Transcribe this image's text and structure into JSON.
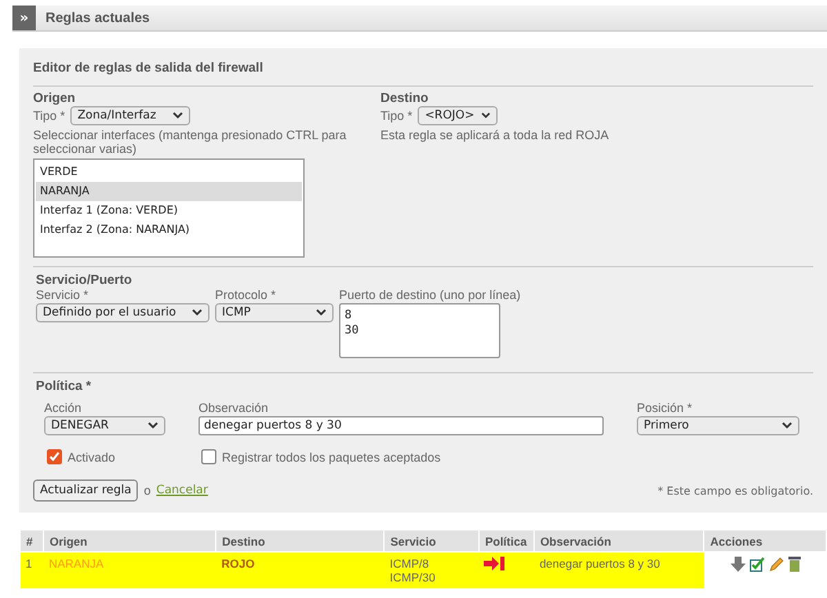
{
  "header": {
    "toggle": "»",
    "title": "Reglas actuales"
  },
  "editor": {
    "title": "Editor de reglas de salida del firewall",
    "origin": {
      "heading": "Origen",
      "type_label": "Tipo *",
      "type_value": "Zona/Interfaz",
      "hint": "Seleccionar interfaces (mantenga presionado CTRL para seleccionar varias)",
      "interfaces": [
        {
          "label": "VERDE",
          "selected": false
        },
        {
          "label": "NARANJA",
          "selected": true
        },
        {
          "label": "Interfaz 1 (Zona: VERDE)",
          "selected": false
        },
        {
          "label": "Interfaz 2 (Zona: NARANJA)",
          "selected": false
        }
      ]
    },
    "destination": {
      "heading": "Destino",
      "type_label": "Tipo *",
      "type_value": "<ROJO>",
      "note": "Esta regla se aplicará a toda la red ROJA"
    },
    "service": {
      "heading": "Servicio/Puerto",
      "service_label": "Servicio *",
      "service_value": "Definido por el usuario",
      "protocol_label": "Protocolo *",
      "protocol_value": "ICMP",
      "ports_label": "Puerto de destino (uno por línea)",
      "ports_value": "8\n30"
    },
    "policy": {
      "heading": "Política *",
      "action_label": "Acción",
      "action_value": "DENEGAR",
      "remark_label": "Observación",
      "remark_value": "denegar puertos 8 y 30",
      "position_label": "Posición *",
      "position_value": "Primero",
      "enabled": {
        "label": "Activado",
        "checked": true
      },
      "log": {
        "label": "Registrar todos los paquetes aceptados",
        "checked": false
      }
    },
    "update_button": "Actualizar regla",
    "or": "o",
    "cancel_link": "Cancelar",
    "required_note": "* Este campo es obligatorio."
  },
  "table": {
    "columns": [
      "#",
      "Origen",
      "Destino",
      "Servicio",
      "Política",
      "Observación",
      "Acciones"
    ],
    "rows": [
      {
        "number": "1",
        "origin": "NARANJA",
        "destination": "ROJO",
        "services": [
          "ICMP/8",
          "ICMP/30"
        ],
        "remark": "denegar puertos 8 y 30",
        "highlighted": true
      }
    ]
  }
}
